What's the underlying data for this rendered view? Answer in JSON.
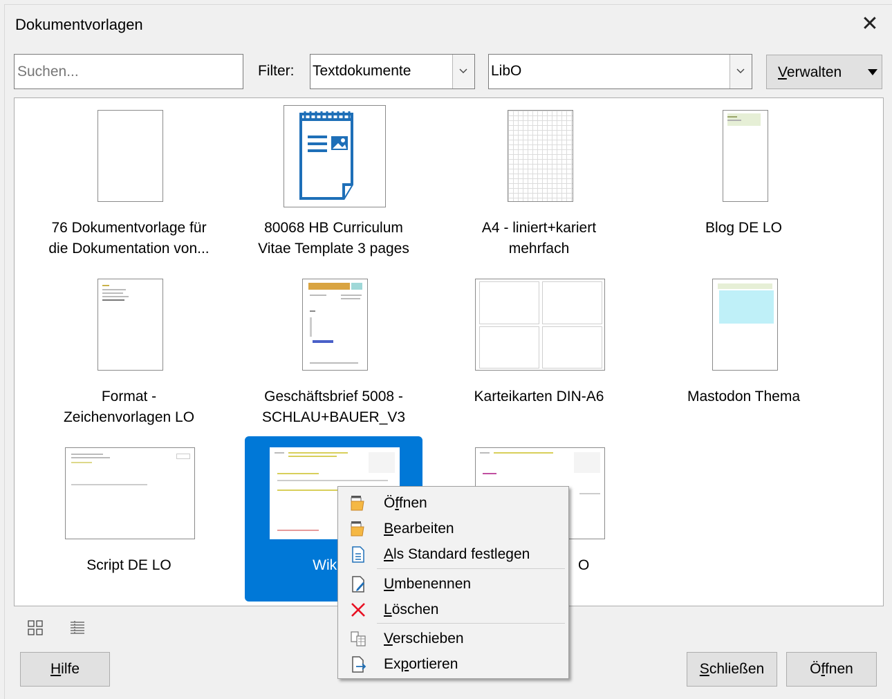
{
  "dialog": {
    "title": "Dokumentvorlagen"
  },
  "toolbar": {
    "search_placeholder": "Suchen...",
    "filter_label": "Filter:",
    "filter_value": "Textdokumente",
    "category_value": "LibO",
    "manage_button": {
      "prefix": "",
      "accel": "V",
      "rest": "erwalten"
    }
  },
  "templates": [
    {
      "line1": "76 Dokumentvorlage für",
      "line2": "die Dokumentation von..."
    },
    {
      "line1": "80068 HB Curriculum",
      "line2": "Vitae Template 3 pages"
    },
    {
      "line1": "A4 - liniert+kariert",
      "line2": "mehrfach"
    },
    {
      "line1": "Blog DE LO",
      "line2": ""
    },
    {
      "line1": "Format -",
      "line2": "Zeichenvorlagen LO"
    },
    {
      "line1": "Geschäftsbrief 5008 -",
      "line2": "SCHLAU+BAUER_V3"
    },
    {
      "line1": "Karteikarten DIN-A6",
      "line2": ""
    },
    {
      "line1": "Mastodon Thema",
      "line2": ""
    },
    {
      "line1": "Script DE LO",
      "line2": ""
    },
    {
      "line1": "Wiki D",
      "line2": "",
      "selected": true
    },
    {
      "line1": "O",
      "line2": ""
    }
  ],
  "context_menu": [
    {
      "icon": "open-icon",
      "prefix": "Ö",
      "accel": "f",
      "rest": "fnen"
    },
    {
      "icon": "edit-icon",
      "prefix": "",
      "accel": "B",
      "rest": "earbeiten"
    },
    {
      "icon": "set-default-icon",
      "prefix": "",
      "accel": "A",
      "rest": "ls Standard festlegen"
    },
    {
      "icon": "rename-icon",
      "prefix": "",
      "accel": "U",
      "rest": "mbenennen"
    },
    {
      "icon": "delete-icon",
      "prefix": "",
      "accel": "L",
      "rest": "öschen"
    },
    {
      "icon": "move-icon",
      "prefix": "",
      "accel": "V",
      "rest": "erschieben"
    },
    {
      "icon": "export-icon",
      "prefix": "Ex",
      "accel": "p",
      "rest": "ortieren"
    }
  ],
  "footer": {
    "help": {
      "prefix": "",
      "accel": "H",
      "rest": "ilfe"
    },
    "close": {
      "prefix": "",
      "accel": "S",
      "rest": "chließen"
    },
    "open": {
      "prefix": "Ö",
      "accel": "f",
      "rest": "fnen"
    }
  },
  "colors": {
    "selection": "#0078d7",
    "delete": "#e81123",
    "icon_blue": "#1e6fb8"
  }
}
